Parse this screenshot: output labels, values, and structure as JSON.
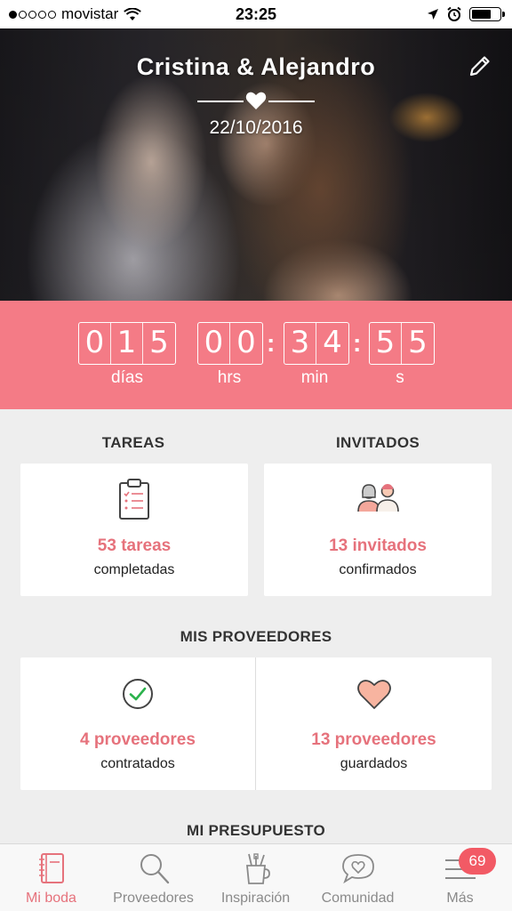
{
  "status_bar": {
    "carrier": "movistar",
    "time": "23:25"
  },
  "hero": {
    "couple_names": "Cristina & Alejandro",
    "date": "22/10/2016"
  },
  "countdown": {
    "days": [
      "0",
      "1",
      "5"
    ],
    "hours": [
      "0",
      "0"
    ],
    "minutes": [
      "3",
      "4"
    ],
    "seconds": [
      "5",
      "5"
    ],
    "labels": {
      "days": "días",
      "hours": "hrs",
      "minutes": "min",
      "seconds": "s"
    }
  },
  "tasks": {
    "title": "TAREAS",
    "value": "53 tareas",
    "subtitle": "completadas"
  },
  "guests": {
    "title": "INVITADOS",
    "value": "13 invitados",
    "subtitle": "confirmados"
  },
  "providers": {
    "title": "MIS PROVEEDORES",
    "hired": {
      "value": "4 proveedores",
      "subtitle": "contratados"
    },
    "saved": {
      "value": "13 proveedores",
      "subtitle": "guardados"
    }
  },
  "budget": {
    "title": "MI PRESUPUESTO"
  },
  "tab_bar": {
    "tabs": [
      {
        "label": "Mi boda",
        "icon": "notebook-icon"
      },
      {
        "label": "Proveedores",
        "icon": "search-icon"
      },
      {
        "label": "Inspiración",
        "icon": "brushes-icon"
      },
      {
        "label": "Comunidad",
        "icon": "chat-heart-icon"
      },
      {
        "label": "Más",
        "icon": "menu-icon"
      }
    ],
    "more_badge": "69"
  },
  "colors": {
    "accent": "#f47b86",
    "accent_text": "#e6727c",
    "badge": "#f25a65",
    "background": "#eeeeee"
  }
}
